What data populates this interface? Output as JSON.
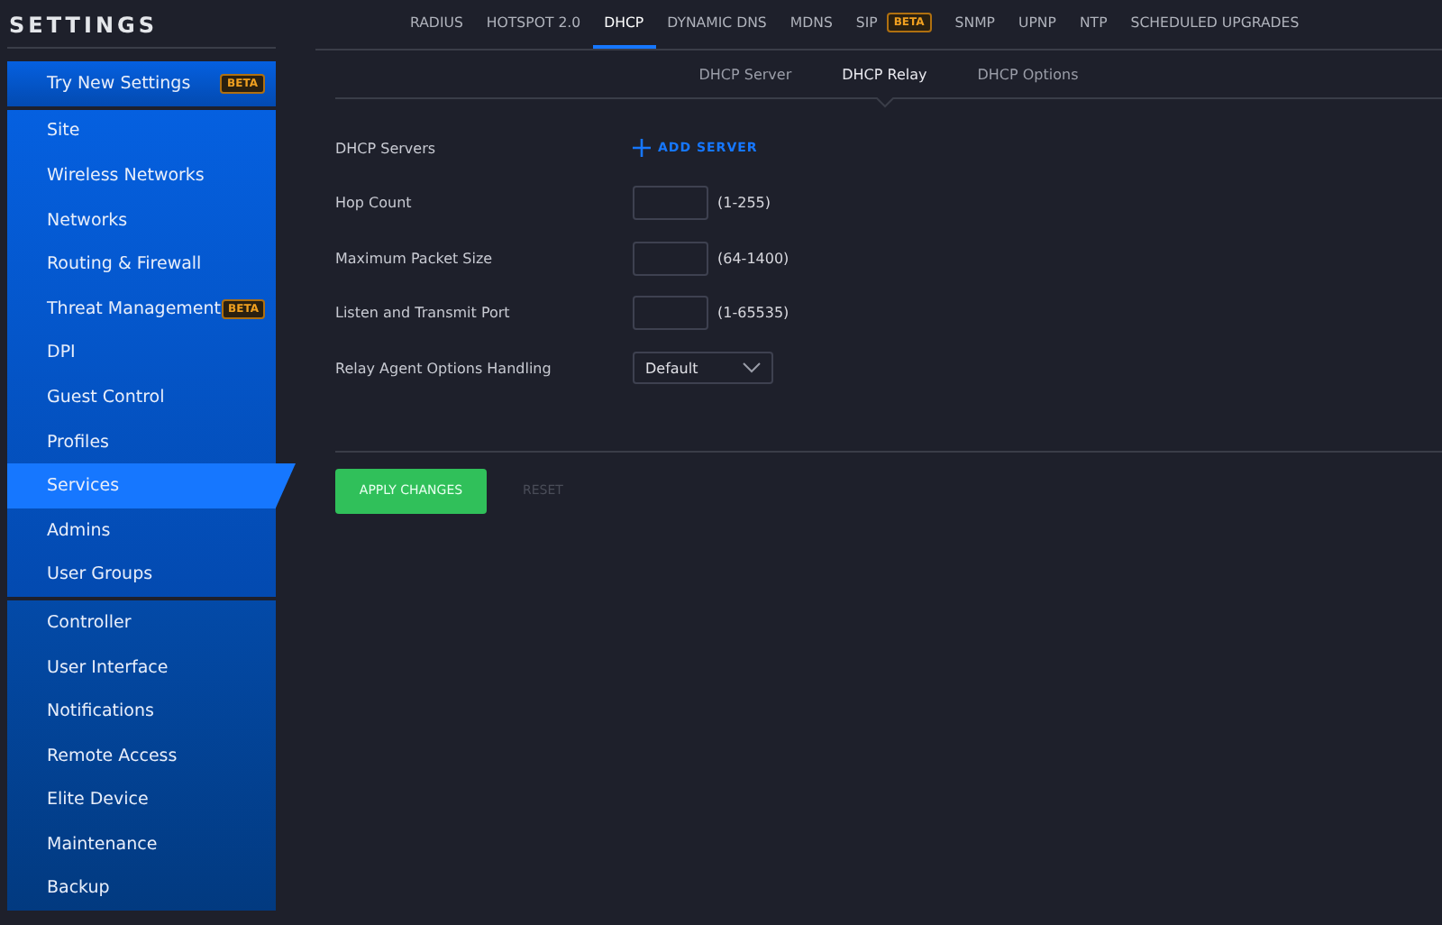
{
  "title": "SETTINGS",
  "sidebar": {
    "groups": [
      [
        {
          "label": "Try New Settings",
          "badge": "BETA",
          "selected": false
        }
      ],
      [
        {
          "label": "Site",
          "selected": false
        },
        {
          "label": "Wireless Networks",
          "selected": false
        },
        {
          "label": "Networks",
          "selected": false
        },
        {
          "label": "Routing & Firewall",
          "selected": false
        },
        {
          "label": "Threat Management",
          "badge": "BETA",
          "selected": false
        },
        {
          "label": "DPI",
          "selected": false
        },
        {
          "label": "Guest Control",
          "selected": false
        },
        {
          "label": "Profiles",
          "selected": false
        },
        {
          "label": "Services",
          "selected": true
        },
        {
          "label": "Admins",
          "selected": false
        },
        {
          "label": "User Groups",
          "selected": false
        }
      ],
      [
        {
          "label": "Controller",
          "selected": false
        },
        {
          "label": "User Interface",
          "selected": false
        },
        {
          "label": "Notifications",
          "selected": false
        },
        {
          "label": "Remote Access",
          "selected": false
        },
        {
          "label": "Elite Device",
          "selected": false
        },
        {
          "label": "Maintenance",
          "selected": false
        },
        {
          "label": "Backup",
          "selected": false
        }
      ]
    ]
  },
  "tabs": [
    {
      "label": "RADIUS",
      "selected": false
    },
    {
      "label": "HOTSPOT 2.0",
      "selected": false
    },
    {
      "label": "DHCP",
      "selected": true
    },
    {
      "label": "DYNAMIC DNS",
      "selected": false
    },
    {
      "label": "MDNS",
      "selected": false
    },
    {
      "label": "SIP",
      "badge": "BETA",
      "selected": false
    },
    {
      "label": "SNMP",
      "selected": false
    },
    {
      "label": "UPNP",
      "selected": false
    },
    {
      "label": "NTP",
      "selected": false
    },
    {
      "label": "SCHEDULED UPGRADES",
      "selected": false
    }
  ],
  "subtabs": [
    {
      "label": "DHCP Server",
      "selected": false
    },
    {
      "label": "DHCP Relay",
      "selected": true
    },
    {
      "label": "DHCP Options",
      "selected": false
    }
  ],
  "form": [
    {
      "kind": "add",
      "label": "DHCP Servers",
      "action": "ADD SERVER"
    },
    {
      "kind": "input",
      "label": "Hop Count",
      "range": "(1-255)"
    },
    {
      "kind": "input",
      "label": "Maximum Packet Size",
      "range": "(64-1400)"
    },
    {
      "kind": "input",
      "label": "Listen and Transmit Port",
      "range": "(1-65535)"
    },
    {
      "kind": "select",
      "label": "Relay Agent Options Handling",
      "value": "Default"
    }
  ],
  "buttons": {
    "apply": "APPLY CHANGES",
    "reset": "RESET"
  }
}
